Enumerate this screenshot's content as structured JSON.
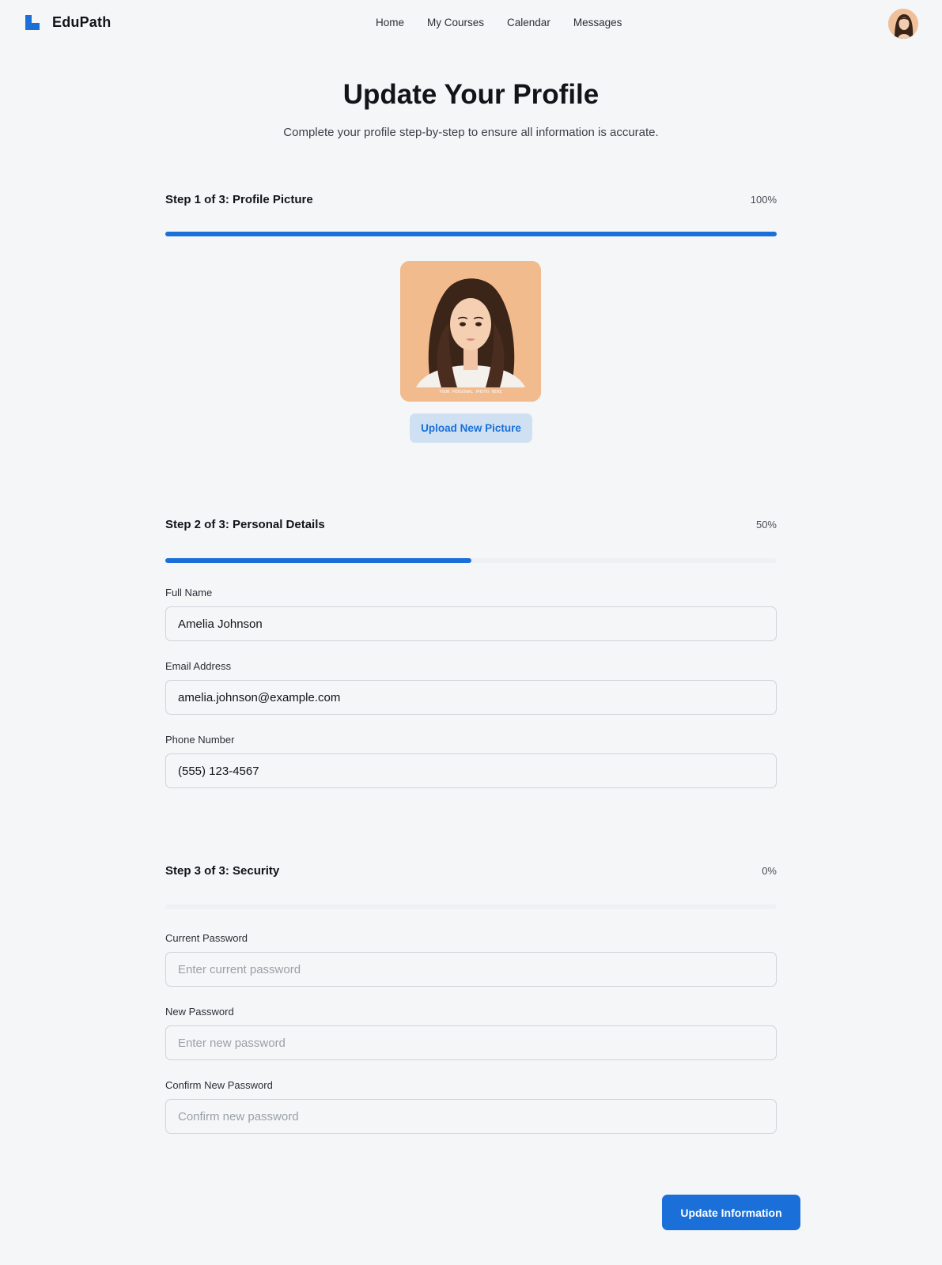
{
  "brand": {
    "name": "EduPath",
    "logo_icon": "edupath-logo-icon"
  },
  "nav": {
    "items": [
      "Home",
      "My Courses",
      "Calendar",
      "Messages"
    ]
  },
  "header": {
    "avatar_icon": "user-avatar"
  },
  "page": {
    "title": "Update Your Profile",
    "subtitle": "Complete your profile step-by-step to ensure all information is accurate."
  },
  "steps": [
    {
      "title": "Step 1 of 3: Profile Picture",
      "percent_label": "100%",
      "progress": 1.0,
      "photo_caption": "YOUR PERSONAL PHOTO HERE",
      "upload_label": "Upload New Picture"
    },
    {
      "title": "Step 2 of 3: Personal Details",
      "percent_label": "50%",
      "progress": 0.5,
      "fields": [
        {
          "label": "Full Name",
          "value": "Amelia Johnson",
          "placeholder": ""
        },
        {
          "label": "Email Address",
          "value": "amelia.johnson@example.com",
          "placeholder": ""
        },
        {
          "label": "Phone Number",
          "value": "(555) 123-4567",
          "placeholder": ""
        }
      ]
    },
    {
      "title": "Step 3 of 3: Security",
      "percent_label": "0%",
      "progress": 0.0,
      "fields": [
        {
          "label": "Current Password",
          "value": "",
          "placeholder": "Enter current password"
        },
        {
          "label": "New Password",
          "value": "",
          "placeholder": "Enter new password"
        },
        {
          "label": "Confirm New Password",
          "value": "",
          "placeholder": "Confirm new password"
        }
      ]
    }
  ],
  "actions": {
    "submit_label": "Update Information"
  },
  "colors": {
    "accent": "#1a6fd8",
    "accent_light": "#cfe0f3",
    "background": "#f5f6f8",
    "photo_bg": "#f2bb8d"
  }
}
